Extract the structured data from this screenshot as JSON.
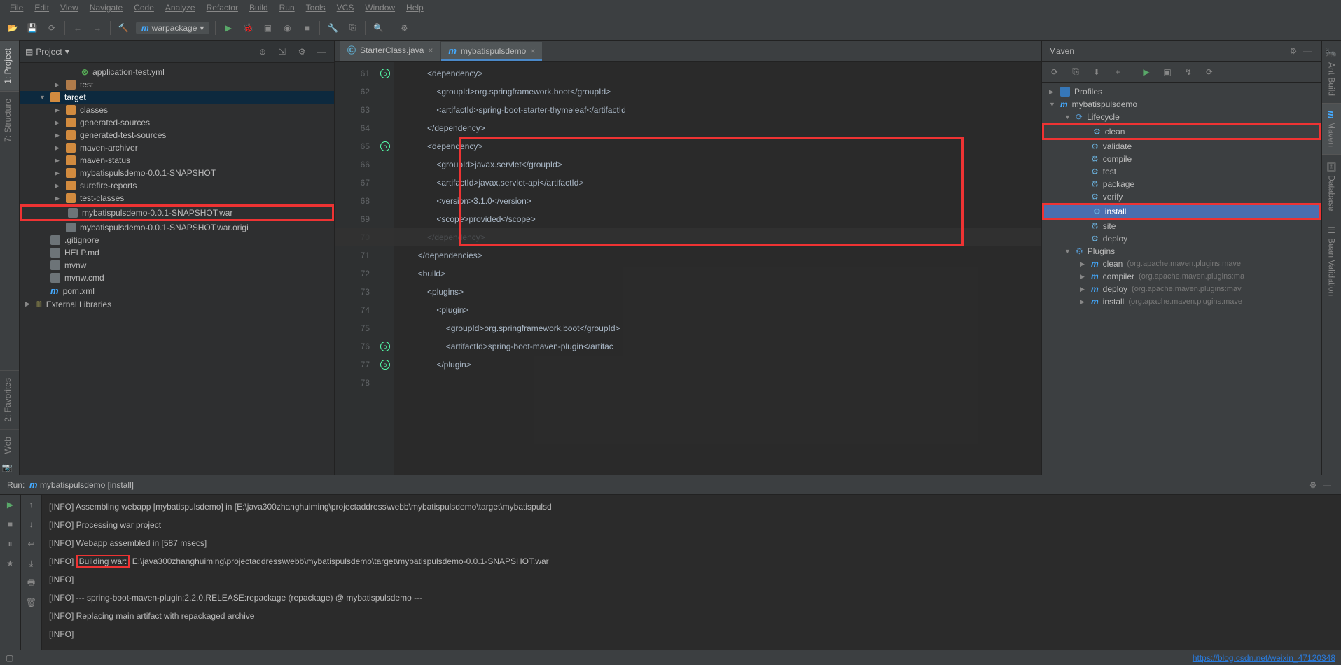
{
  "menu": {
    "file": "File",
    "edit": "Edit",
    "view": "View",
    "navigate": "Navigate",
    "code": "Code",
    "analyze": "Analyze",
    "refactor": "Refactor",
    "build": "Build",
    "run": "Run",
    "tools": "Tools",
    "vcs": "VCS",
    "window": "Window",
    "help": "Help"
  },
  "toolbar": {
    "runconfig": "warpackage"
  },
  "leftTabs": {
    "project": "1: Project",
    "structure": "7: Structure",
    "favorites": "2: Favorites",
    "web": "Web"
  },
  "projectPanel": {
    "title": "Project",
    "items": [
      {
        "label": "application-test.yml",
        "indent": 3,
        "icon": "yml",
        "arrow": ""
      },
      {
        "label": "test",
        "indent": 2,
        "icon": "folder",
        "arrow": "▶"
      },
      {
        "label": "target",
        "indent": 1,
        "icon": "folder2",
        "arrow": "▼",
        "selected": false,
        "highlight": true
      },
      {
        "label": "classes",
        "indent": 2,
        "icon": "folder2",
        "arrow": "▶"
      },
      {
        "label": "generated-sources",
        "indent": 2,
        "icon": "folder2",
        "arrow": "▶"
      },
      {
        "label": "generated-test-sources",
        "indent": 2,
        "icon": "folder2",
        "arrow": "▶"
      },
      {
        "label": "maven-archiver",
        "indent": 2,
        "icon": "folder2",
        "arrow": "▶"
      },
      {
        "label": "maven-status",
        "indent": 2,
        "icon": "folder2",
        "arrow": "▶"
      },
      {
        "label": "mybatispulsdemo-0.0.1-SNAPSHOT",
        "indent": 2,
        "icon": "folder2",
        "arrow": "▶"
      },
      {
        "label": "surefire-reports",
        "indent": 2,
        "icon": "folder2",
        "arrow": "▶"
      },
      {
        "label": "test-classes",
        "indent": 2,
        "icon": "folder2",
        "arrow": "▶"
      },
      {
        "label": "mybatispulsdemo-0.0.1-SNAPSHOT.war",
        "indent": 2,
        "icon": "file",
        "arrow": "",
        "redbox": true
      },
      {
        "label": "mybatispulsdemo-0.0.1-SNAPSHOT.war.origi",
        "indent": 2,
        "icon": "file",
        "arrow": ""
      },
      {
        "label": ".gitignore",
        "indent": 1,
        "icon": "file",
        "arrow": ""
      },
      {
        "label": "HELP.md",
        "indent": 1,
        "icon": "file",
        "arrow": ""
      },
      {
        "label": "mvnw",
        "indent": 1,
        "icon": "file",
        "arrow": ""
      },
      {
        "label": "mvnw.cmd",
        "indent": 1,
        "icon": "file",
        "arrow": ""
      },
      {
        "label": "pom.xml",
        "indent": 1,
        "icon": "m",
        "arrow": ""
      },
      {
        "label": "External Libraries",
        "indent": 0,
        "icon": "lib",
        "arrow": "▶"
      }
    ]
  },
  "editor": {
    "tabs": [
      {
        "label": "StarterClass.java",
        "icon": "c",
        "active": false
      },
      {
        "label": "mybatispulsdemo",
        "icon": "m",
        "active": true
      }
    ],
    "startLine": 61,
    "lines": [
      "            <dependency>",
      "                <groupId>org.springframework.boot</groupId>",
      "                <artifactId>spring-boot-starter-thymeleaf</artifactId",
      "            </dependency>",
      "            <dependency>",
      "                <groupId>javax.servlet</groupId>",
      "                <artifactId>javax.servlet-api</artifactId>",
      "                <version>3.1.0</version>",
      "                <scope>provided</scope>",
      "            </dependency>",
      "        </dependencies>",
      "",
      "        <build>",
      "            <plugins>",
      "                <plugin>",
      "                    <groupId>org.springframework.boot</groupId>",
      "                    <artifactId>spring-boot-maven-plugin</artifac",
      "                </plugin>"
    ]
  },
  "maven": {
    "title": "Maven",
    "tree": [
      {
        "label": "Profiles",
        "indent": 0,
        "arrow": "▶",
        "icon": "profile"
      },
      {
        "label": "mybatispulsdemo",
        "indent": 0,
        "arrow": "▼",
        "icon": "m"
      },
      {
        "label": "Lifecycle",
        "indent": 1,
        "arrow": "▼",
        "icon": "lifecycle"
      },
      {
        "label": "clean",
        "indent": 2,
        "arrow": "",
        "icon": "gear",
        "redbox": true
      },
      {
        "label": "validate",
        "indent": 2,
        "arrow": "",
        "icon": "gear"
      },
      {
        "label": "compile",
        "indent": 2,
        "arrow": "",
        "icon": "gear"
      },
      {
        "label": "test",
        "indent": 2,
        "arrow": "",
        "icon": "gear"
      },
      {
        "label": "package",
        "indent": 2,
        "arrow": "",
        "icon": "gear"
      },
      {
        "label": "verify",
        "indent": 2,
        "arrow": "",
        "icon": "gear"
      },
      {
        "label": "install",
        "indent": 2,
        "arrow": "",
        "icon": "gear",
        "selected": true,
        "redbox": true
      },
      {
        "label": "site",
        "indent": 2,
        "arrow": "",
        "icon": "gear"
      },
      {
        "label": "deploy",
        "indent": 2,
        "arrow": "",
        "icon": "gear"
      },
      {
        "label": "Plugins",
        "indent": 1,
        "arrow": "▼",
        "icon": "plugin"
      },
      {
        "label": "clean",
        "extra": "(org.apache.maven.plugins:mave",
        "indent": 2,
        "arrow": "▶",
        "icon": "m"
      },
      {
        "label": "compiler",
        "extra": "(org.apache.maven.plugins:ma",
        "indent": 2,
        "arrow": "▶",
        "icon": "m"
      },
      {
        "label": "deploy",
        "extra": "(org.apache.maven.plugins:mav",
        "indent": 2,
        "arrow": "▶",
        "icon": "m"
      },
      {
        "label": "install",
        "extra": "(org.apache.maven.plugins:mave",
        "indent": 2,
        "arrow": "▶",
        "icon": "m"
      }
    ]
  },
  "rightTabs": {
    "ant": "Ant Build",
    "maven": "Maven",
    "database": "Database",
    "bean": "Bean Validation"
  },
  "run": {
    "title": "Run:",
    "config": "mybatispulsdemo [install]",
    "lines": [
      "[INFO] Assembling webapp [mybatispulsdemo] in [E:\\java300zhanghuiming\\projectaddress\\webb\\mybatispulsdemo\\target\\mybatispulsd",
      "[INFO] Processing war project",
      "[INFO] Webapp assembled in [587 msecs]",
      "[INFO] Building war: E:\\java300zhanghuiming\\projectaddress\\webb\\mybatispulsdemo\\target\\mybatispulsdemo-0.0.1-SNAPSHOT.war",
      "[INFO]",
      "[INFO] --- spring-boot-maven-plugin:2.2.0.RELEASE:repackage (repackage) @ mybatispulsdemo ---",
      "[INFO] Replacing main artifact with repackaged archive",
      "[INFO]"
    ],
    "buildingWar": "Building war:"
  },
  "status": {
    "url": "https://blog.csdn.net/weixin_47120348"
  }
}
